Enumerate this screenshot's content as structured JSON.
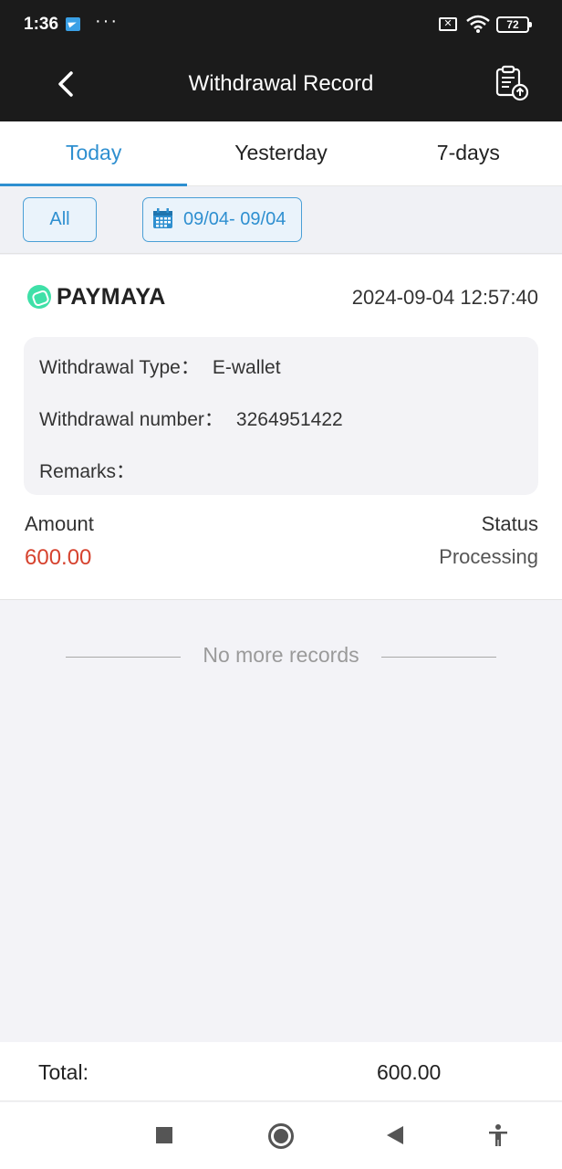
{
  "status_bar": {
    "time": "1:36",
    "dots": "···",
    "sim": "✕",
    "battery": "72"
  },
  "header": {
    "title": "Withdrawal Record",
    "back_icon": "chevron-left-icon",
    "action_icon": "clipboard-upload-icon"
  },
  "tabs": [
    {
      "label": "Today",
      "active": true
    },
    {
      "label": "Yesterday",
      "active": false
    },
    {
      "label": "7-days",
      "active": false
    }
  ],
  "filter": {
    "all_label": "All",
    "date_range": "09/04- 09/04"
  },
  "record": {
    "channel": "PAYMAYA",
    "datetime": "2024-09-04 12:57:40",
    "withdrawal_type_label": "Withdrawal Type：",
    "withdrawal_type_value": "E-wallet",
    "withdrawal_number_label": "Withdrawal number：",
    "withdrawal_number_value": "3264951422",
    "remarks_label": "Remarks：",
    "remarks_value": "",
    "amount_label": "Amount",
    "amount_value": "600.00",
    "status_label": "Status",
    "status_value": "Processing"
  },
  "list_end": "No more records",
  "total": {
    "label": "Total:",
    "value": "600.00"
  },
  "colors": {
    "accent": "#2e8fd0",
    "amount": "#d6432f",
    "header_bg": "#1b1b1b",
    "brand_green": "#3fe0a8"
  }
}
